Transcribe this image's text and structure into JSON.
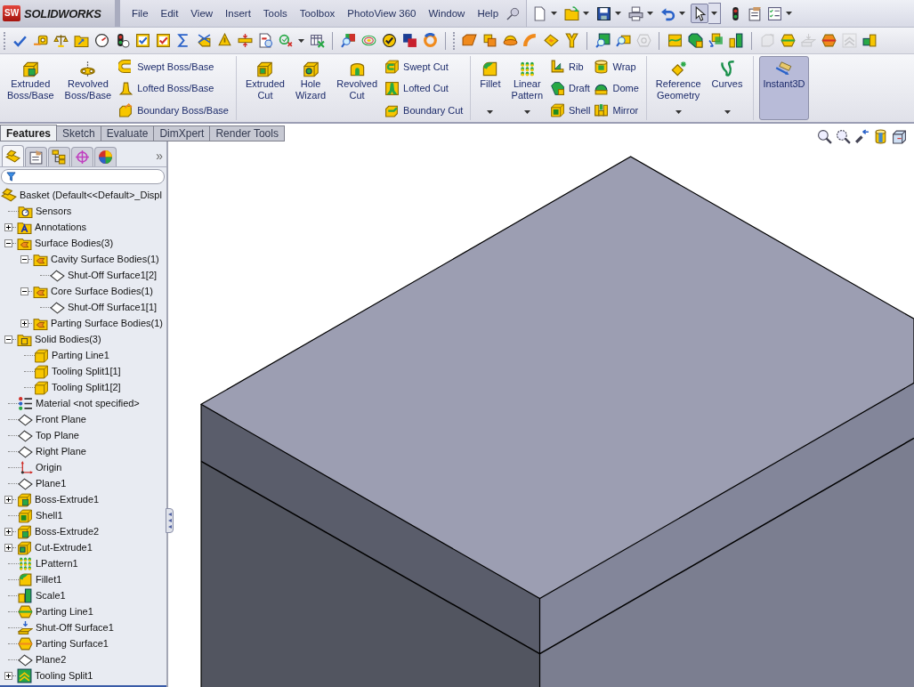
{
  "app": {
    "logo_mark": "SW",
    "name": "SOLIDWORKS"
  },
  "menu": [
    "File",
    "Edit",
    "View",
    "Insert",
    "Tools",
    "Toolbox",
    "PhotoView 360",
    "Window",
    "Help"
  ],
  "quick_access": [
    {
      "kind": "new-document",
      "menu": true,
      "selected": false
    },
    {
      "kind": "open",
      "menu": true,
      "selected": false
    },
    {
      "kind": "save",
      "menu": true,
      "selected": false
    },
    {
      "kind": "print",
      "menu": true,
      "selected": false
    },
    {
      "kind": "undo",
      "menu": true,
      "selected": false
    },
    {
      "kind": "select",
      "menu": true,
      "selected": true
    },
    {
      "kind": "rebuild",
      "menu": false,
      "selected": false
    },
    {
      "kind": "file-properties",
      "menu": false,
      "selected": false
    },
    {
      "kind": "options",
      "menu": true,
      "selected": false
    }
  ],
  "toolbar_groups": [
    [
      {
        "kind": "spell-check",
        "menu": false,
        "disabled": false
      },
      {
        "kind": "measure",
        "menu": false,
        "disabled": false
      },
      {
        "kind": "mass-properties",
        "menu": false,
        "disabled": false
      },
      {
        "kind": "section-properties",
        "menu": false,
        "disabled": false
      },
      {
        "kind": "performance",
        "menu": false,
        "disabled": false
      },
      {
        "kind": "statistics",
        "menu": false,
        "disabled": false
      },
      {
        "kind": "check-blue",
        "menu": false,
        "disabled": false
      },
      {
        "kind": "check-red",
        "menu": false,
        "disabled": false
      },
      {
        "kind": "sigma",
        "menu": false,
        "disabled": false
      },
      {
        "kind": "import-diagnostics",
        "menu": false,
        "disabled": false
      },
      {
        "kind": "deviation",
        "menu": false,
        "disabled": false
      },
      {
        "kind": "interference",
        "menu": false,
        "disabled": false
      },
      {
        "kind": "geometry-analysis",
        "menu": false,
        "disabled": false
      },
      {
        "kind": "check-x",
        "menu": true,
        "disabled": false
      },
      {
        "kind": "compare",
        "menu": false,
        "disabled": false
      }
    ],
    [
      {
        "kind": "draft-analysis",
        "menu": false,
        "disabled": false
      },
      {
        "kind": "zebra",
        "menu": false,
        "disabled": false
      },
      {
        "kind": "curvature",
        "menu": false,
        "disabled": false
      },
      {
        "kind": "thickness",
        "menu": false,
        "disabled": false
      },
      {
        "kind": "ring",
        "menu": false,
        "disabled": false
      }
    ],
    [
      {
        "kind": "plane-surface",
        "menu": false,
        "disabled": false
      },
      {
        "kind": "offset-surface",
        "menu": false,
        "disabled": false
      },
      {
        "kind": "dome-surface",
        "menu": false,
        "disabled": false
      },
      {
        "kind": "sweep-surface",
        "menu": false,
        "disabled": false
      },
      {
        "kind": "planar-surface",
        "menu": false,
        "disabled": false
      },
      {
        "kind": "y-surface",
        "menu": false,
        "disabled": false
      }
    ],
    [
      {
        "kind": "box-magnifier",
        "menu": false,
        "disabled": false
      },
      {
        "kind": "magnifier",
        "menu": false,
        "disabled": false
      },
      {
        "kind": "hexagon",
        "menu": false,
        "disabled": true
      }
    ],
    [
      {
        "kind": "box-line",
        "menu": false,
        "disabled": false
      },
      {
        "kind": "prism",
        "menu": false,
        "disabled": false
      },
      {
        "kind": "boxes-arrow",
        "menu": false,
        "disabled": false
      },
      {
        "kind": "bars",
        "menu": false,
        "disabled": false
      }
    ],
    [
      {
        "kind": "sparkle-box",
        "menu": false,
        "disabled": true
      },
      {
        "kind": "hexagon-line",
        "menu": false,
        "disabled": false
      },
      {
        "kind": "tray",
        "menu": false,
        "disabled": true
      },
      {
        "kind": "hexagon-orange",
        "menu": false,
        "disabled": false
      },
      {
        "kind": "chevrons",
        "menu": false,
        "disabled": true
      },
      {
        "kind": "blocks",
        "menu": false,
        "disabled": false
      }
    ]
  ],
  "command_groups": [
    {
      "large": [
        {
          "kind": "extrude-boss",
          "label": "Extruded\nBoss/Base",
          "menu": false,
          "selected": false
        },
        {
          "kind": "revolve-boss",
          "label": "Revolved\nBoss/Base",
          "menu": false,
          "selected": false
        }
      ],
      "small_columns": [
        [
          {
            "kind": "swept-boss",
            "label": "Swept Boss/Base"
          },
          {
            "kind": "lofted-boss",
            "label": "Lofted Boss/Base"
          },
          {
            "kind": "boundary-boss",
            "label": "Boundary Boss/Base"
          }
        ]
      ]
    },
    {
      "large": [
        {
          "kind": "extrude-cut",
          "label": "Extruded\nCut",
          "menu": false,
          "selected": false
        },
        {
          "kind": "hole-wizard",
          "label": "Hole\nWizard",
          "menu": false,
          "selected": false
        },
        {
          "kind": "revolve-cut",
          "label": "Revolved\nCut",
          "menu": false,
          "selected": false
        }
      ],
      "small_columns": [
        [
          {
            "kind": "swept-cut",
            "label": "Swept Cut"
          },
          {
            "kind": "lofted-cut",
            "label": "Lofted Cut"
          },
          {
            "kind": "boundary-cut",
            "label": "Boundary Cut"
          }
        ]
      ]
    },
    {
      "large": [
        {
          "kind": "fillet",
          "label": "Fillet",
          "menu": true,
          "selected": false
        },
        {
          "kind": "linear-pattern",
          "label": "Linear\nPattern",
          "menu": true,
          "selected": false
        }
      ],
      "small_columns": [
        [
          {
            "kind": "rib",
            "label": "Rib"
          },
          {
            "kind": "draft",
            "label": "Draft"
          },
          {
            "kind": "shell",
            "label": "Shell"
          }
        ],
        [
          {
            "kind": "wrap",
            "label": "Wrap"
          },
          {
            "kind": "dome",
            "label": "Dome"
          },
          {
            "kind": "mirror",
            "label": "Mirror"
          }
        ]
      ]
    },
    {
      "large": [
        {
          "kind": "reference-geometry",
          "label": "Reference\nGeometry",
          "menu": true,
          "selected": false
        },
        {
          "kind": "curves",
          "label": "Curves",
          "menu": true,
          "selected": false
        }
      ]
    },
    {
      "large": [
        {
          "kind": "instant3d",
          "label": "Instant3D",
          "menu": false,
          "selected": true
        }
      ]
    }
  ],
  "tabs": [
    {
      "label": "Features",
      "selected": true
    },
    {
      "label": "Sketch",
      "selected": false
    },
    {
      "label": "Evaluate",
      "selected": false
    },
    {
      "label": "DimXpert",
      "selected": false
    },
    {
      "label": "Render Tools",
      "selected": false
    }
  ],
  "panel_tabs": [
    {
      "kind": "feature-manager",
      "selected": true
    },
    {
      "kind": "property-manager",
      "selected": false
    },
    {
      "kind": "configuration-manager",
      "selected": false
    },
    {
      "kind": "dimxpert-manager",
      "selected": false
    },
    {
      "kind": "display-manager",
      "selected": false
    }
  ],
  "panel_overflow": "»",
  "feature_tree": {
    "root": {
      "label": "Basket  (Default<<Default>_Displ",
      "kind": "part",
      "children": [
        {
          "label": "Sensors",
          "kind": "sensors"
        },
        {
          "label": "Annotations",
          "kind": "annotations",
          "expanded": false
        },
        {
          "label": "Surface Bodies(3)",
          "kind": "surface-folder",
          "expanded": true,
          "children": [
            {
              "label": "Cavity Surface Bodies(1)",
              "kind": "surface-folder",
              "expanded": true,
              "children": [
                {
                  "label": "Shut-Off Surface1[2]",
                  "kind": "surface-body"
                }
              ]
            },
            {
              "label": "Core Surface Bodies(1)",
              "kind": "surface-folder",
              "expanded": true,
              "children": [
                {
                  "label": "Shut-Off Surface1[1]",
                  "kind": "surface-body"
                }
              ]
            },
            {
              "label": "Parting Surface Bodies(1)",
              "kind": "surface-folder",
              "expanded": false
            }
          ]
        },
        {
          "label": "Solid Bodies(3)",
          "kind": "solid-folder",
          "expanded": true,
          "children": [
            {
              "label": "Parting Line1",
              "kind": "solid-body"
            },
            {
              "label": "Tooling Split1[1]",
              "kind": "solid-body"
            },
            {
              "label": "Tooling Split1[2]",
              "kind": "solid-body"
            }
          ]
        },
        {
          "label": "Material <not specified>",
          "kind": "material"
        },
        {
          "label": "Front Plane",
          "kind": "plane"
        },
        {
          "label": "Top Plane",
          "kind": "plane"
        },
        {
          "label": "Right Plane",
          "kind": "plane"
        },
        {
          "label": "Origin",
          "kind": "origin"
        },
        {
          "label": "Plane1",
          "kind": "plane"
        },
        {
          "label": "Boss-Extrude1",
          "kind": "extrude",
          "expanded": false
        },
        {
          "label": "Shell1",
          "kind": "shell"
        },
        {
          "label": "Boss-Extrude2",
          "kind": "extrude",
          "expanded": false
        },
        {
          "label": "Cut-Extrude1",
          "kind": "cut",
          "expanded": false
        },
        {
          "label": "LPattern1",
          "kind": "pattern"
        },
        {
          "label": "Fillet1",
          "kind": "fillet"
        },
        {
          "label": "Scale1",
          "kind": "scale"
        },
        {
          "label": "Parting Line1",
          "kind": "parting-line"
        },
        {
          "label": "Shut-Off Surface1",
          "kind": "shutoff"
        },
        {
          "label": "Parting Surface1",
          "kind": "parting-surface"
        },
        {
          "label": "Plane2",
          "kind": "plane"
        },
        {
          "label": "Tooling Split1",
          "kind": "tooling-split",
          "expanded": false
        }
      ]
    }
  },
  "heads_up": [
    {
      "kind": "zoom-fit"
    },
    {
      "kind": "zoom-area"
    },
    {
      "kind": "previous-view"
    },
    {
      "kind": "section-view"
    },
    {
      "kind": "view-orientation"
    }
  ]
}
